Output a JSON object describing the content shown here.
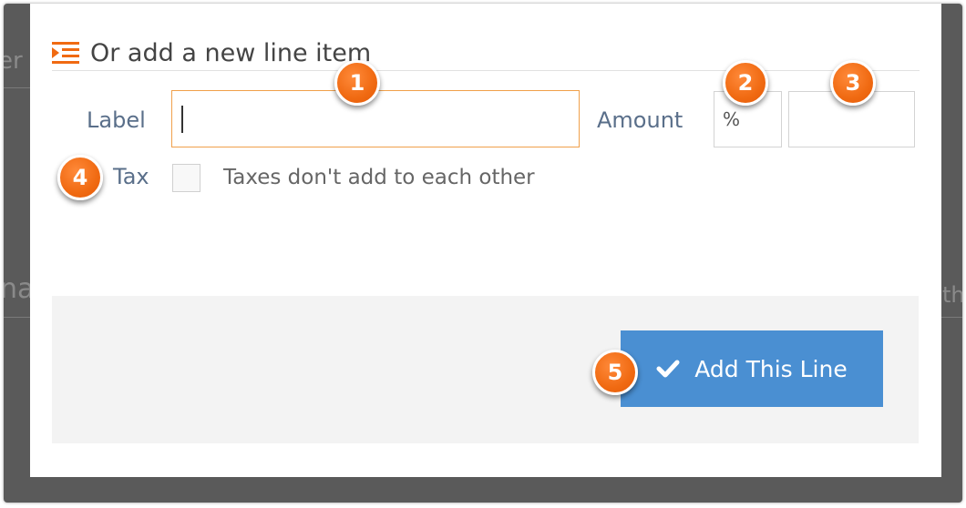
{
  "modal": {
    "title": "Or add a new line item",
    "label_field": {
      "label": "Label",
      "value": ""
    },
    "amount_field": {
      "label": "Amount",
      "unit": "%",
      "value": ""
    },
    "tax_field": {
      "label": "Tax",
      "checked": false,
      "note": "Taxes don't add to each other"
    },
    "add_button": {
      "label": "Add This Line",
      "icon": "check-icon"
    }
  },
  "background": {
    "left_fragment_top": "er",
    "left_fragment_mid": "na",
    "right_fragment_mid": "th"
  },
  "callouts": [
    "1",
    "2",
    "3",
    "4",
    "5"
  ],
  "colors": {
    "accent_orange": "#f06a12",
    "button_blue": "#4a8fd2",
    "label_slate": "#5a6f8a",
    "focus_border": "#f0a04b"
  }
}
